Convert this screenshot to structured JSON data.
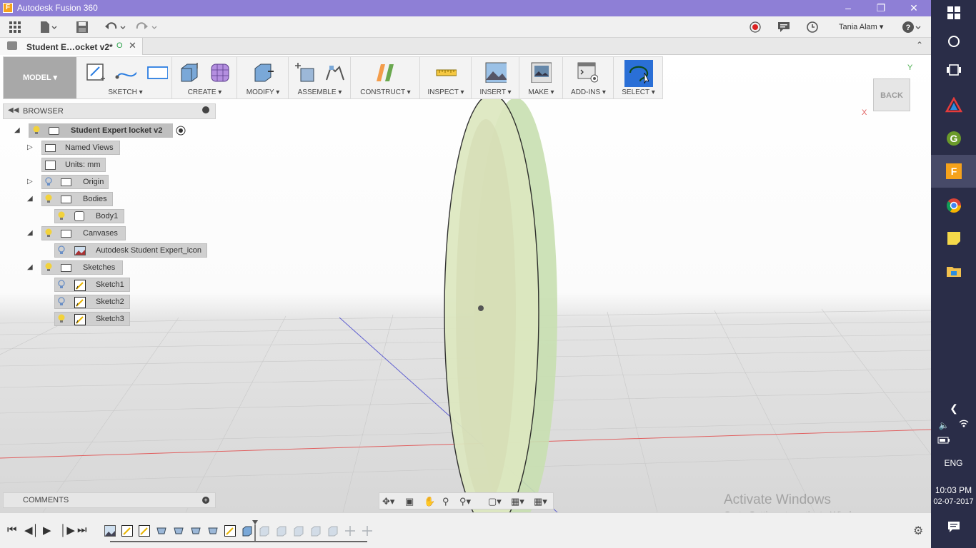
{
  "window": {
    "title": "Autodesk Fusion 360",
    "app_icon": "F",
    "controls": [
      "minimize-icon",
      "restore-icon",
      "close-icon"
    ]
  },
  "qat": {
    "user": "Tania Alam",
    "icons": [
      "grid-icon",
      "file-icon",
      "save-icon",
      "undo-icon",
      "redo-icon",
      "record-icon",
      "comment-icon",
      "clock-icon",
      "help-icon"
    ]
  },
  "tab": {
    "label": "Student E…ocket v2*",
    "status": "O"
  },
  "toolbar": {
    "workspace": "MODEL ▾",
    "groups": [
      {
        "label": "SKETCH ▾"
      },
      {
        "label": "CREATE ▾"
      },
      {
        "label": "MODIFY ▾"
      },
      {
        "label": "ASSEMBLE ▾"
      },
      {
        "label": "CONSTRUCT ▾"
      },
      {
        "label": "INSPECT ▾"
      },
      {
        "label": "INSERT ▾"
      },
      {
        "label": "MAKE ▾"
      },
      {
        "label": "ADD-INS ▾"
      },
      {
        "label": "SELECT ▾"
      }
    ]
  },
  "browser": {
    "header": "BROWSER",
    "root": "Student Expert locket v2",
    "items": [
      {
        "label": "Named Views"
      },
      {
        "label": "Units: mm"
      },
      {
        "label": "Origin"
      },
      {
        "label": "Bodies"
      },
      {
        "label": "Body1"
      },
      {
        "label": "Canvases"
      },
      {
        "label": "Autodesk Student Expert_icon"
      },
      {
        "label": "Sketches"
      },
      {
        "label": "Sketch1"
      },
      {
        "label": "Sketch2"
      },
      {
        "label": "Sketch3"
      }
    ]
  },
  "comments": {
    "label": "COMMENTS",
    "add": "+"
  },
  "viewcube": {
    "face": "BACK",
    "x": "X",
    "y": "Y"
  },
  "watermark": {
    "line1": "Activate Windows",
    "line2": "Go to Settings to activate Windows."
  },
  "taskbar": {
    "language": "ENG",
    "time": "10:03 PM",
    "date": "02-07-2017"
  },
  "colors": {
    "titlebar": "#8e7fd6",
    "taskbar": "#2a2d48",
    "body_green": "#c8dfb0",
    "x_axis": "#e06060",
    "z_axis": "#6060d0"
  }
}
